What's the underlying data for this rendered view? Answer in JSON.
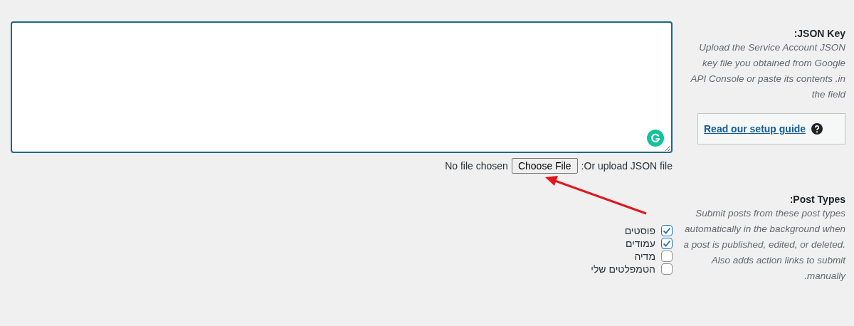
{
  "json_key": {
    "label": ":JSON Key",
    "description": "Upload the Service Account JSON key file you obtained from Google API Console or paste its contents .in the field",
    "guide_link": "Read our setup guide",
    "upload_label": ":Or upload JSON file",
    "file_button": "Choose File",
    "file_status": "No file chosen"
  },
  "post_types": {
    "label": ":Post Types",
    "description": "Submit posts from these post types automatically in the background when a post is published, edited, or deleted. Also adds action links to submit .manually",
    "options": [
      {
        "label": "פוסטים",
        "checked": true
      },
      {
        "label": "עמודים",
        "checked": true
      },
      {
        "label": "מדיה",
        "checked": false
      },
      {
        "label": "הטמפלטים שלי",
        "checked": false
      }
    ]
  }
}
